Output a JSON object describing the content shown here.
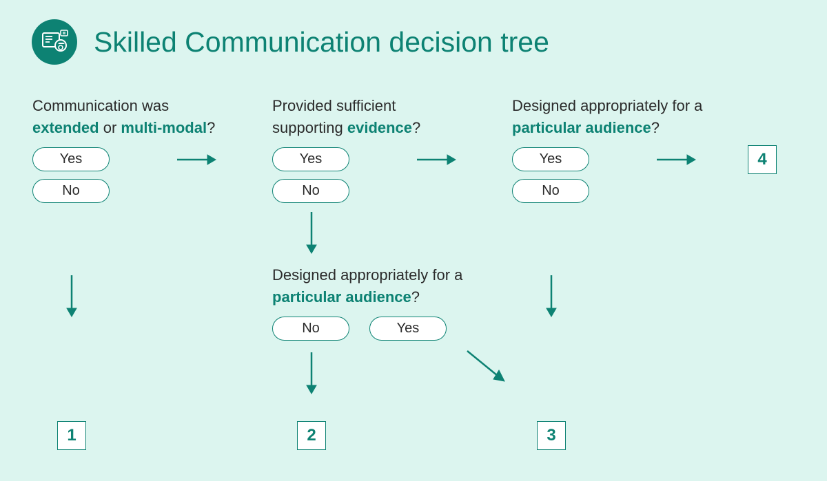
{
  "title": "Skilled Communication decision tree",
  "questions": {
    "q1a": "Communication was ",
    "q1b": "extended",
    "q1c": " or ",
    "q1d": "multi-modal",
    "q1e": "?",
    "q2a": "Provided sufficient supporting ",
    "q2b": "evidence",
    "q2c": "?",
    "q3a": "Designed appropriately for a ",
    "q3b": "particular audience",
    "q3c": "?",
    "q4a": "Designed appropriately for a ",
    "q4b": "particular audience",
    "q4c": "?"
  },
  "labels": {
    "yes": "Yes",
    "no": "No"
  },
  "outcomes": {
    "o1": "1",
    "o2": "2",
    "o3": "3",
    "o4": "4"
  }
}
